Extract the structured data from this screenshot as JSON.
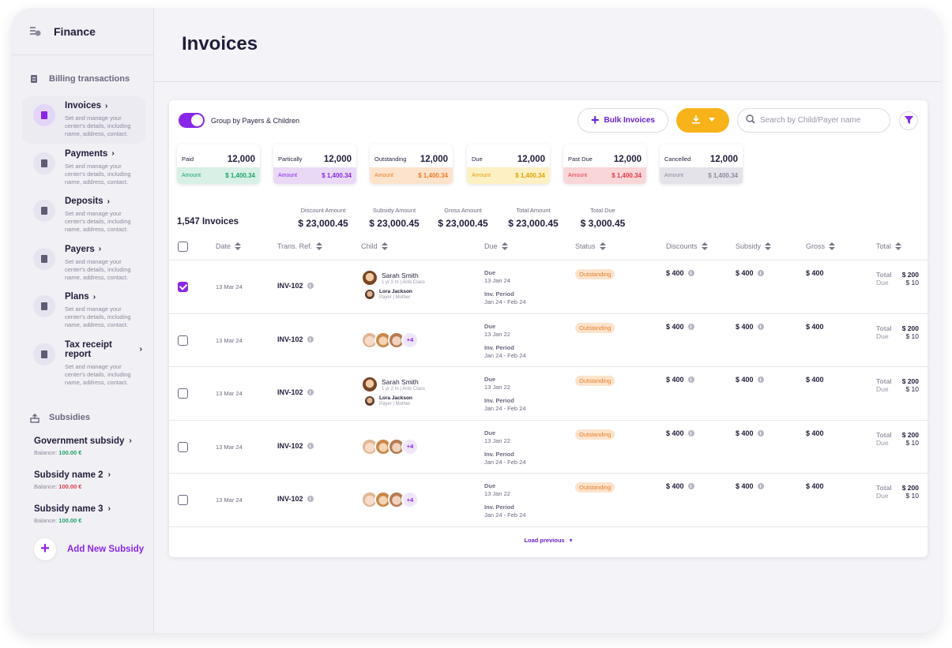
{
  "brand": {
    "title": "Finance"
  },
  "sidebar": {
    "billing_section": "Billing transactions",
    "items": [
      {
        "label": "Invoices",
        "desc": "Set and manage your center's details, including name, address, contact."
      },
      {
        "label": "Payments",
        "desc": "Set and manage your center's details, including name, address, contact."
      },
      {
        "label": "Deposits",
        "desc": "Set and manage your center's details, including name, address, contact."
      },
      {
        "label": "Payers",
        "desc": "Set and manage your center's details, including name, address, contact."
      },
      {
        "label": "Plans",
        "desc": "Set and manage your center's details, including name, address, contact."
      },
      {
        "label": "Tax receipt report",
        "desc": "Set and manage your center's details, including name, address, contact."
      }
    ],
    "subsidies_section": "Subsidies",
    "subsidies": [
      {
        "name": "Government subsidy",
        "balance_label": "Balance:",
        "balance": "100.00 €"
      },
      {
        "name": "Subsidy name 2",
        "balance_label": "Balance:",
        "balance": "100.00 €"
      },
      {
        "name": "Subsidy name 3",
        "balance_label": "Balance:",
        "balance": "100.00 €"
      }
    ],
    "add_subsidy": "Add New Subsidy"
  },
  "page": {
    "title": "Invoices"
  },
  "toolbar": {
    "group_toggle_label": "Group by Payers & Children",
    "bulk_label": "Bulk Invoices",
    "search_placeholder": "Search by Child/Payer name"
  },
  "stats": [
    {
      "name": "Paid",
      "count": "12,000",
      "amount_label": "Amount",
      "amount": "$ 1,400.34",
      "bg": "#d8f0e6",
      "fg": "#1ea36a"
    },
    {
      "name": "Partically",
      "count": "12,000",
      "amount_label": "Amount",
      "amount": "$ 1,400.34",
      "bg": "#ead9f6",
      "fg": "#8a26e8"
    },
    {
      "name": "Outstanding",
      "count": "12,000",
      "amount_label": "Amount",
      "amount": "$ 1,400.34",
      "bg": "#fde3cc",
      "fg": "#e87e2a"
    },
    {
      "name": "Due",
      "count": "12,000",
      "amount_label": "Amount",
      "amount": "$ 1,400.34",
      "bg": "#fdf1c4",
      "fg": "#e0a208"
    },
    {
      "name": "Past Due",
      "count": "12,000",
      "amount_label": "Amount",
      "amount": "$ 1,400.34",
      "bg": "#f9d6d8",
      "fg": "#e23b4a"
    },
    {
      "name": "Cancelled",
      "count": "12,000",
      "amount_label": "Amount",
      "amount": "$ 1,400.34",
      "bg": "#e4e3ea",
      "fg": "#8d8a9c"
    }
  ],
  "summary": {
    "count": "1,547 Invoices",
    "discount_label": "Discount Amount",
    "discount": "$ 23,000.45",
    "subsidy_label": "Subsidy Amount",
    "subsidy": "$ 23,000.45",
    "gross_label": "Gross Amount",
    "gross": "$ 23,000.45",
    "total_label": "Total Amount",
    "total": "$ 23,000.45",
    "due_label": "Total Due",
    "due": "$ 3,000.45"
  },
  "table": {
    "columns": [
      "Date",
      "Trans. Ref.",
      "Child",
      "Due",
      "Status",
      "Discounts",
      "Subsidy",
      "Gross",
      "Total"
    ],
    "rows": [
      {
        "checked": true,
        "date": "13 Mar 24",
        "ref": "INV-102",
        "child_type": "single",
        "child_name": "Sarah Smith",
        "child_sub": "1 yr 2 m | Ants Class",
        "payer_name": "Lora Jackson",
        "payer_role": "Payer | Mother",
        "due_label": "Due",
        "due_date": "13 Jan 24",
        "period_label": "Inv. Period",
        "period": "Jan 24 - Feb 24",
        "status": "Outstanding",
        "discounts": "$ 400",
        "subsidy": "$ 400",
        "gross": "$ 400",
        "total_label": "Total",
        "total": "$ 200",
        "due2_label": "Due",
        "due2": "$ 10"
      },
      {
        "checked": false,
        "date": "13 Mar 24",
        "ref": "INV-102",
        "child_type": "group",
        "more": "+4",
        "due_label": "Due",
        "due_date": "13 Jan 22",
        "period_label": "Inv. Period",
        "period": "Jan 24 - Feb 24",
        "status": "Outstanding",
        "discounts": "$ 400",
        "subsidy": "$ 400",
        "gross": "$ 400",
        "total_label": "Total",
        "total": "$ 200",
        "due2_label": "Due",
        "due2": "$ 10"
      },
      {
        "checked": false,
        "date": "13 Mar 24",
        "ref": "INV-102",
        "child_type": "single",
        "child_name": "Sarah Smith",
        "child_sub": "1 yr 2 m | Ants Class",
        "payer_name": "Lora Jackson",
        "payer_role": "Payer | Mother",
        "due_label": "Due",
        "due_date": "13 Jan 22",
        "period_label": "Inv. Period",
        "period": "Jan 24 - Feb 24",
        "status": "Outstanding",
        "discounts": "$ 400",
        "subsidy": "$ 400",
        "gross": "$ 400",
        "total_label": "Total",
        "total": "$ 200",
        "due2_label": "Due",
        "due2": "$ 10"
      },
      {
        "checked": false,
        "date": "13 Mar 24",
        "ref": "INV-102",
        "child_type": "group",
        "more": "+4",
        "due_label": "Due",
        "due_date": "13 Jan 22",
        "period_label": "Inv. Period",
        "period": "Jan 24 - Feb 24",
        "status": "Outstanding",
        "discounts": "$ 400",
        "subsidy": "$ 400",
        "gross": "$ 400",
        "total_label": "Total",
        "total": "$ 200",
        "due2_label": "Due",
        "due2": "$ 10"
      },
      {
        "checked": false,
        "date": "13 Mar 24",
        "ref": "INV-102",
        "child_type": "group",
        "more": "+4",
        "due_label": "Due",
        "due_date": "13 Jan 22",
        "period_label": "Inv. Period",
        "period": "Jan 24 - Feb 24",
        "status": "Outstanding",
        "discounts": "$ 400",
        "subsidy": "$ 400",
        "gross": "$ 400",
        "total_label": "Total",
        "total": "$ 200",
        "due2_label": "Due",
        "due2": "$ 10"
      }
    ],
    "load_previous": "Load previous"
  }
}
